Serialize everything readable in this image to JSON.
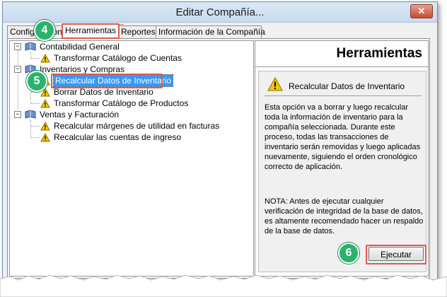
{
  "window": {
    "title": "Editar Compañía..."
  },
  "tabs": [
    {
      "label": "Configuración"
    },
    {
      "label": "Herramientas"
    },
    {
      "label": "Reportes"
    },
    {
      "label": "Información de la Compañía"
    }
  ],
  "tree": {
    "groups": [
      {
        "label": "Contabilidad General",
        "items": [
          "Transformar Catálogo de Cuentas"
        ]
      },
      {
        "label": "Inventarios y Compras",
        "items": [
          "Recalcular Datos de Inventario",
          "Borrar Datos de Inventario",
          "Transformar Catálogo de Productos"
        ]
      },
      {
        "label": "Ventas y Facturación",
        "items": [
          "Recalcular márgenes de utilidad en facturas",
          "Recalcular las cuentas de ingreso"
        ]
      }
    ],
    "selected_item": "Recalcular Datos de Inventario"
  },
  "panel": {
    "header": "Herramientas",
    "tool_title": "Recalcular Datos de Inventario",
    "description": "Esta opción va a borrar y luego recalcular toda la información de inventario para la compañía seleccionada.  Durante este proceso, todas las transacciones de inventario serán removidas y luego aplicadas nuevamente, siguiendo el orden cronológico correcto de aplicación.",
    "note": "NOTA: Antes de ejecutar cualquier verificación de integridad de la base de datos, es altamente recomendado hacer un respaldo de la base de datos.",
    "execute_label": "Ejecutar"
  },
  "callouts": {
    "step_tab": "4",
    "step_item": "5",
    "step_button": "6"
  },
  "colors": {
    "callout": "#2db26e",
    "highlight": "#e05a4a",
    "selection": "#3399ff"
  }
}
